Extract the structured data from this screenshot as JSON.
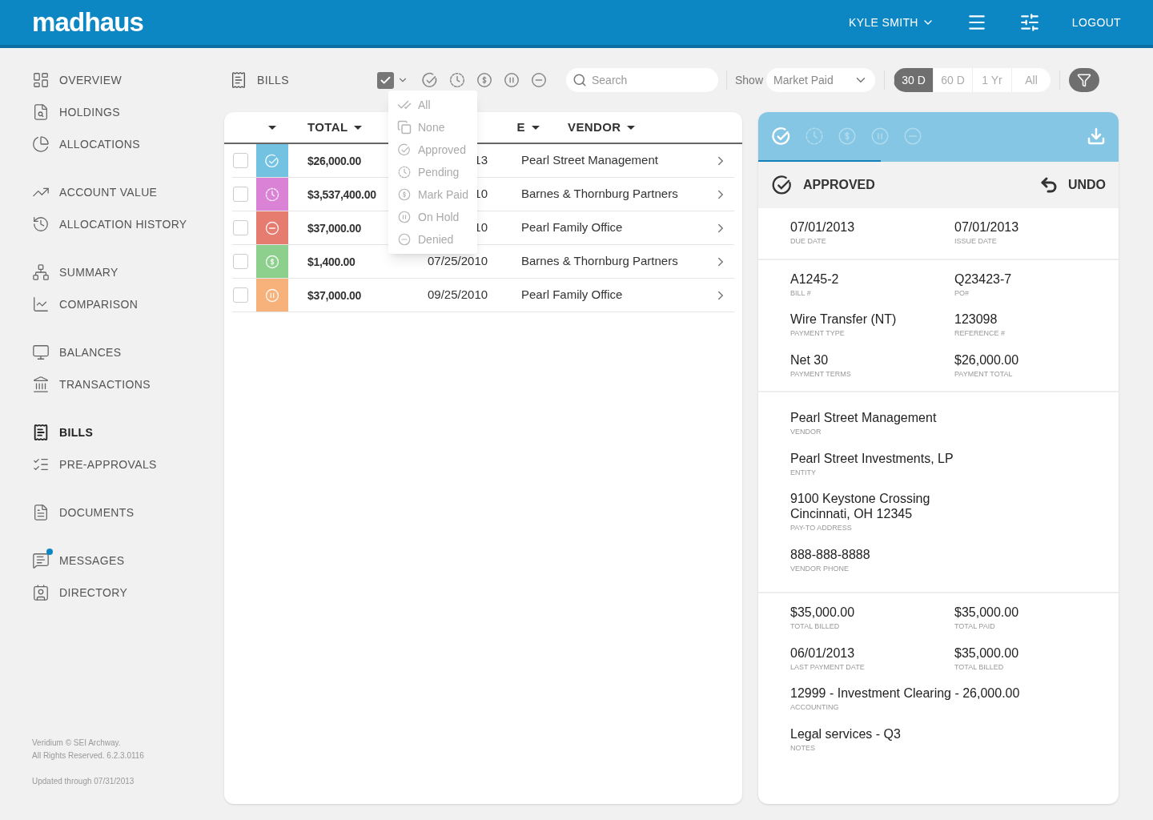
{
  "header": {
    "logo": "madhaus",
    "user": "KYLE SMITH",
    "logout": "LOGOUT"
  },
  "sidebar": {
    "groups": [
      {
        "items": [
          {
            "label": "OVERVIEW",
            "selected": false,
            "unread": false
          },
          {
            "label": "HOLDINGS",
            "selected": false,
            "unread": false
          },
          {
            "label": "ALLOCATIONS",
            "selected": false,
            "unread": false
          }
        ]
      },
      {
        "items": [
          {
            "label": "ACCOUNT VALUE",
            "selected": false,
            "unread": false
          },
          {
            "label": "ALLOCATION HISTORY",
            "selected": false,
            "unread": false
          }
        ]
      },
      {
        "items": [
          {
            "label": "SUMMARY",
            "selected": false,
            "unread": false
          },
          {
            "label": "COMPARISON",
            "selected": false,
            "unread": false
          }
        ]
      },
      {
        "items": [
          {
            "label": "BALANCES",
            "selected": false,
            "unread": false
          },
          {
            "label": "TRANSACTIONS",
            "selected": false,
            "unread": false
          }
        ]
      },
      {
        "items": [
          {
            "label": "BILLS",
            "selected": true,
            "unread": false
          },
          {
            "label": "PRE-APPROVALS",
            "selected": false,
            "unread": false
          }
        ]
      },
      {
        "items": [
          {
            "label": "DOCUMENTS",
            "selected": false,
            "unread": false
          }
        ]
      },
      {
        "items": [
          {
            "label": "MESSAGES",
            "selected": false,
            "unread": true
          },
          {
            "label": "DIRECTORY",
            "selected": false,
            "unread": false
          }
        ]
      }
    ],
    "footer": [
      "Veridium © SEI Archway.",
      "All Rights Reserved. 6.2.3.0116",
      "Updated through 07/31/2013"
    ]
  },
  "toolbar": {
    "title": "BILLS",
    "select_all_checked": true,
    "status_filters": [
      {
        "kind": "approved"
      },
      {
        "kind": "pending"
      },
      {
        "kind": "paid"
      },
      {
        "kind": "hold"
      },
      {
        "kind": "denied"
      }
    ],
    "search": {
      "placeholder": "Search"
    },
    "show_label": "Show",
    "show_select": "Market Paid",
    "ranges": [
      {
        "label": "30 D",
        "selected": true
      },
      {
        "label": "60 D",
        "selected": false
      },
      {
        "label": "1 Yr",
        "selected": false
      },
      {
        "label": "All",
        "selected": false
      }
    ]
  },
  "select_menu": [
    {
      "kind": "all",
      "label": "All"
    },
    {
      "kind": "none",
      "label": "None"
    },
    {
      "kind": "approved",
      "label": "Approved"
    },
    {
      "kind": "pending",
      "label": "Pending"
    },
    {
      "kind": "paid",
      "label": "Mark Paid"
    },
    {
      "kind": "hold",
      "label": "On Hold"
    },
    {
      "kind": "denied",
      "label": "Denied"
    }
  ],
  "table": {
    "columns": [
      "",
      "TOTAL",
      "E",
      "VENDOR"
    ],
    "rows": [
      {
        "checked": false,
        "kind": "approved",
        "color": "#74c2e1",
        "total": "$26,000.00",
        "date": "13",
        "vendor": "Pearl Street Management"
      },
      {
        "checked": false,
        "kind": "pending",
        "color": "#d982d6",
        "total": "$3,537,400.00",
        "date": "10",
        "vendor": "Barnes & Thornburg Partners"
      },
      {
        "checked": false,
        "kind": "denied",
        "color": "#e67b70",
        "total": "$37,000.00",
        "date": "10",
        "vendor": "Pearl Family Office"
      },
      {
        "checked": false,
        "kind": "paid",
        "color": "#8dd08e",
        "total": "$1,400.00",
        "date": "07/25/2010",
        "vendor": "Barnes & Thornburg Partners"
      },
      {
        "checked": false,
        "kind": "hold",
        "color": "#f6b27a",
        "total": "$37,000.00",
        "date": "09/25/2010",
        "vendor": "Pearl Family Office"
      }
    ]
  },
  "detail": {
    "tabs": [
      {
        "kind": "approved",
        "selected": true
      },
      {
        "kind": "pending",
        "selected": false
      },
      {
        "kind": "paid",
        "selected": false
      },
      {
        "kind": "hold",
        "selected": false
      },
      {
        "kind": "denied",
        "selected": false
      }
    ],
    "status": "APPROVED",
    "undo": "UNDO",
    "sections": [
      {
        "rows": [
          [
            {
              "value": "07/01/2013",
              "label": "DUE DATE"
            },
            {
              "value": "07/01/2013",
              "label": "ISSUE DATE"
            }
          ]
        ]
      },
      {
        "rows": [
          [
            {
              "value": "A1245-2",
              "label": "BILL #"
            },
            {
              "value": "Q23423-7",
              "label": "PO#"
            }
          ],
          [
            {
              "value": "Wire Transfer (NT)",
              "label": "PAYMENT TYPE"
            },
            {
              "value": "123098",
              "label": "REFERENCE #"
            }
          ],
          [
            {
              "value": "Net 30",
              "label": "PAYMENT TERMS"
            },
            {
              "value": "$26,000.00",
              "label": "PAYMENT TOTAL"
            }
          ]
        ]
      },
      {
        "rows": [
          [
            {
              "value": "Pearl Street Management",
              "label": "VENDOR"
            }
          ],
          [
            {
              "value": "Pearl Street Investments, LP",
              "label": "ENTITY"
            }
          ],
          [
            {
              "value": "9100 Keystone Crossing\nCincinnati, OH 12345",
              "label": "PAY-TO ADDRESS"
            }
          ],
          [
            {
              "value": "888-888-8888",
              "label": "VENDOR PHONE"
            }
          ]
        ]
      },
      {
        "rows": [
          [
            {
              "value": "$35,000.00",
              "label": "TOTAL BILLED"
            },
            {
              "value": "$35,000.00",
              "label": "TOTAL PAID"
            }
          ],
          [
            {
              "value": "06/01/2013",
              "label": "LAST PAYMENT DATE"
            },
            {
              "value": "$35,000.00",
              "label": "TOTAL BILLED"
            }
          ],
          [
            {
              "value": "12999 - Investment Clearing - 26,000.00",
              "label": "ACCOUNTING"
            }
          ],
          [
            {
              "value": "Legal services - Q3",
              "label": "NOTES"
            }
          ]
        ]
      }
    ]
  }
}
